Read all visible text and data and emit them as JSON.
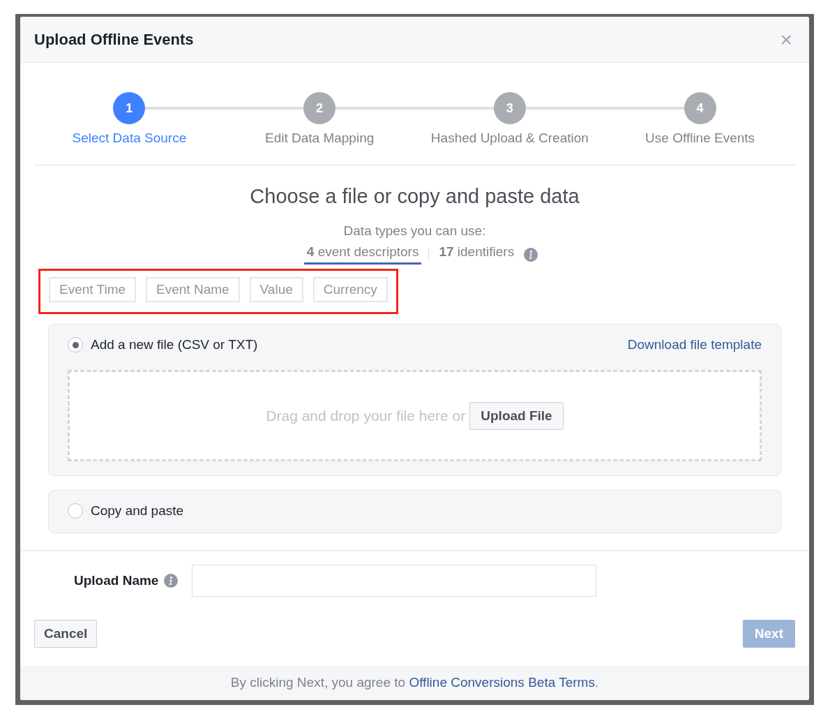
{
  "dialog": {
    "title": "Upload Offline Events",
    "close": "×"
  },
  "steps": [
    {
      "number": "1",
      "label": "Select Data Source",
      "selected": true
    },
    {
      "number": "2",
      "label": "Edit Data Mapping",
      "selected": false
    },
    {
      "number": "3",
      "label": "Hashed Upload & Creation",
      "selected": false
    },
    {
      "number": "4",
      "label": "Use Offline Events",
      "selected": false
    }
  ],
  "heading": "Choose a file or copy and paste data",
  "data_types": {
    "label": "Data types you can use:",
    "tabs": [
      {
        "label": "**4** event descriptors",
        "selected": true
      },
      {
        "label": "**17** identifiers",
        "selected": false
      }
    ]
  },
  "descriptor_tags": [
    "Event Time",
    "Event Name",
    "Value",
    "Currency"
  ],
  "options": [
    {
      "kind": "file",
      "label": "Add a new file (CSV or TXT)",
      "selected": true,
      "link": "Download file template",
      "dropzone_text": "Drag and drop your file here or",
      "button": "Upload File"
    },
    {
      "kind": "paste",
      "label": "Copy and paste",
      "selected": false
    }
  ],
  "upload_name": {
    "label": "Upload Name"
  },
  "buttons": {
    "cancel": "Cancel",
    "next": {
      "label": "Next",
      "disabled": true
    }
  },
  "footer": {
    "text": "By clicking Next, you agree to",
    "link": "Offline Conversions Beta Terms",
    "end": "."
  }
}
